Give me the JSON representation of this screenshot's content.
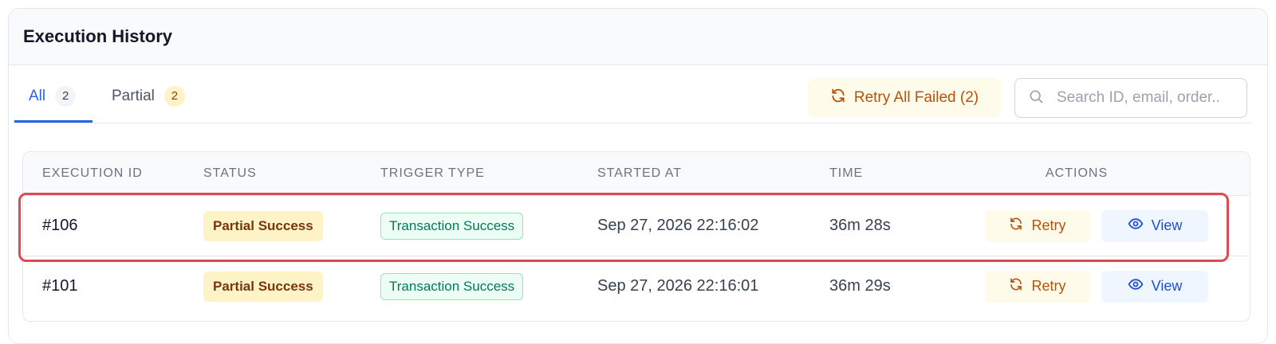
{
  "header": {
    "title": "Execution History"
  },
  "tabs": [
    {
      "label": "All",
      "count": "2"
    },
    {
      "label": "Partial",
      "count": "2"
    }
  ],
  "toolbar": {
    "retry_all_label": "Retry All Failed (2)",
    "search_placeholder": "Search ID, email, order..",
    "search_value": ""
  },
  "table": {
    "columns": [
      "EXECUTION ID",
      "STATUS",
      "TRIGGER TYPE",
      "STARTED AT",
      "TIME",
      "ACTIONS"
    ],
    "rows": [
      {
        "id": "#106",
        "status": "Partial Success",
        "trigger": "Transaction Success",
        "started_at": "Sep 27, 2026 22:16:02",
        "time": "36m 28s",
        "retry_label": "Retry",
        "view_label": "View"
      },
      {
        "id": "#101",
        "status": "Partial Success",
        "trigger": "Transaction Success",
        "started_at": "Sep 27, 2026 22:16:01",
        "time": "36m 29s",
        "retry_label": "Retry",
        "view_label": "View"
      }
    ]
  },
  "icons": {
    "retry": "refresh-icon",
    "search": "search-icon",
    "view": "eye-icon"
  },
  "colors": {
    "accent": "#2563eb",
    "retry": "#b45309",
    "partial_badge_bg": "#fef3c7",
    "trigger_badge": "#047857",
    "highlight": "#dc4a52"
  }
}
